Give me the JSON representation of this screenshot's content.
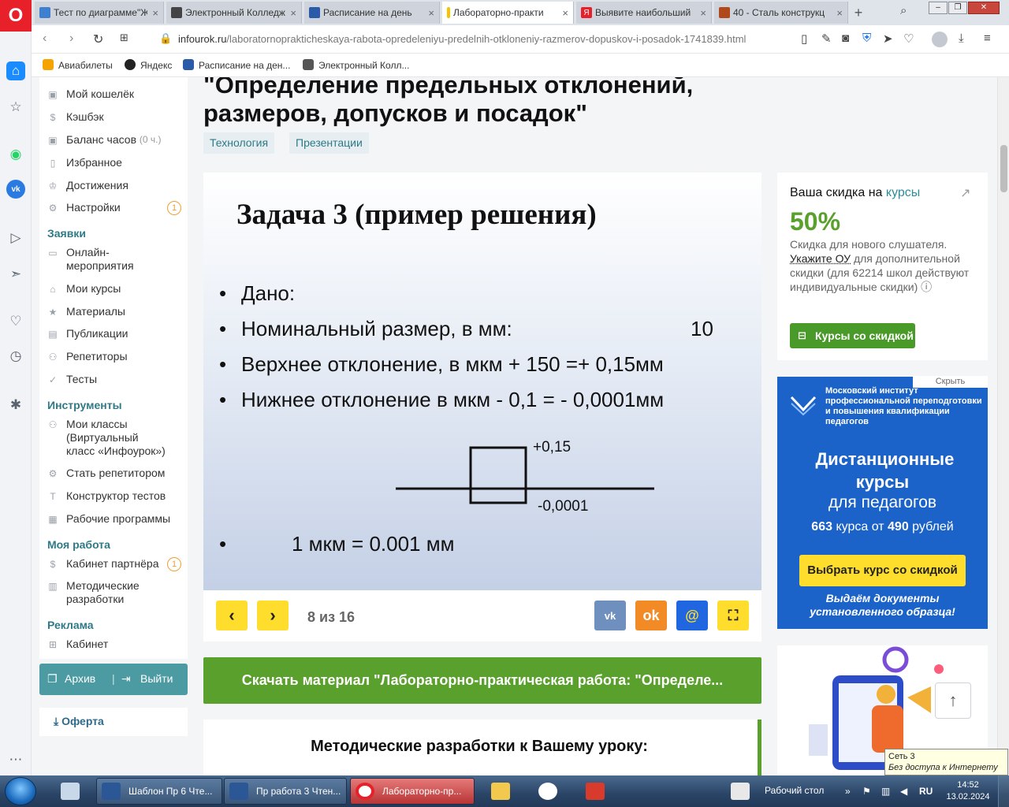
{
  "browser": {
    "tabs": [
      {
        "label": "Тест по диаграмме\"Ж",
        "active": false,
        "color": "#3f7fd0"
      },
      {
        "label": "Электронный Колледж",
        "active": false,
        "color": "#444444"
      },
      {
        "label": "Расписание на день",
        "active": false,
        "color": "#2a5aa8"
      },
      {
        "label": "Лабораторно-практи",
        "active": true,
        "color": "#f5c400"
      },
      {
        "label": "Выявите наибольший",
        "active": false,
        "color": "#e8202a"
      },
      {
        "label": "40 - Сталь конструкц",
        "active": false,
        "color": "#b0481c"
      }
    ],
    "url_host": "infourok.ru",
    "url_path": "/laboratornoprakticheskaya-rabota-opredeleniyu-predelnih-otkloneniy-razmerov-dopuskov-i-posadok-1741839.html",
    "bookmarks": [
      {
        "label": "Авиабилеты",
        "color": "#f5a300"
      },
      {
        "label": "Яндекс",
        "color": "#222222"
      },
      {
        "label": "Расписание на ден...",
        "color": "#2a5aa8"
      },
      {
        "label": "Электронный Колл...",
        "color": "#555555"
      }
    ]
  },
  "sidebar": {
    "items": [
      {
        "label": "Мой кошелёк",
        "icon": "wallet-icon"
      },
      {
        "label": "Кэшбэк",
        "icon": "cashback-icon"
      },
      {
        "label": "Баланс часов",
        "suffix": "(0 ч.)",
        "icon": "hours-icon"
      },
      {
        "label": "Избранное",
        "icon": "bookmark-icon"
      },
      {
        "label": "Достижения",
        "icon": "trophy-icon"
      },
      {
        "label": "Настройки",
        "icon": "gear-icon",
        "badge": "1"
      }
    ],
    "sections": [
      {
        "title": "Заявки",
        "items": [
          "Онлайн-мероприятия",
          "Мои курсы",
          "Материалы",
          "Публикации",
          "Репетиторы",
          "Тесты"
        ]
      },
      {
        "title": "Инструменты",
        "items": [
          "Мои классы (Виртуальный класс «Инфоурок»)",
          "Стать репетитором",
          "Конструктор тестов",
          "Рабочие программы"
        ]
      },
      {
        "title": "Моя работа",
        "items": [
          "Кабинет партнёра",
          "Методические разработки"
        ],
        "badge": "1"
      },
      {
        "title": "Реклама",
        "items": [
          "Кабинет"
        ]
      }
    ],
    "archive_label": "Архив",
    "logout_label": "Выйти",
    "oferta_label": "Оферта"
  },
  "main": {
    "title_line1": "\"Определение предельных отклонений,",
    "title_line2": "размеров, допусков и посадок\"",
    "tags": [
      "Технология",
      "Презентации"
    ],
    "slide": {
      "title": "Задача 3 (пример решения)",
      "given": "Дано:",
      "nominal_label": "Номинальный размер, в мм:",
      "nominal_value": "10",
      "upper": "Верхнее отклонение, в мкм  + 150 =+ 0,15мм",
      "lower": "Нижнее отклонение в мкм  - 0,1 = - 0,0001мм",
      "label_upper": "+0,15",
      "label_lower": "-0,0001",
      "conversion": "1 мкм = 0.001  мм"
    },
    "counter": "8 из 16",
    "share": [
      "vk-icon",
      "ok-icon",
      "mail-icon",
      "fullscreen-icon"
    ],
    "download_label": "Скачать материал \"Лабораторно-практическая работа: \"Определе...",
    "methods_title": "Методические разработки к Вашему уроку:"
  },
  "promo": {
    "head": "Ваша скидка на ",
    "head_link": "курсы",
    "percent": "50%",
    "desc_1": "Скидка для нового слушателя.",
    "desc_link": "Укажите ОУ",
    "desc_2": " для дополнительной скидки (для 62214 школ действуют индивидуальные скидки)",
    "button": "Курсы со скидкой"
  },
  "ad": {
    "hide": "Скрыть",
    "org": "Московский институт профессиональной переподготовки и повышения квалификации педагогов",
    "big1": "Дистанционные курсы",
    "big2": "для педагогов",
    "price_count": "663",
    "price_mid": " курса от ",
    "price_value": "490",
    "price_unit": " рублей",
    "button": "Выбрать курс со скидкой",
    "foot": "Выдаём документы установленного образца!"
  },
  "tooltip": {
    "line1": "Сеть  3",
    "line2": "Без доступа к Интернету"
  },
  "taskbar": {
    "items": [
      {
        "label": "Шаблон Пр 6 Чте...",
        "color": "#2b5797"
      },
      {
        "label": "Пр работа 3 Чтен...",
        "color": "#2b5797"
      },
      {
        "label": "Лабораторно-пр...",
        "color": "#e8202a",
        "active": true
      }
    ],
    "desktop_label": "Рабочий стол",
    "lang": "RU",
    "time": "14:52",
    "date": "13.02.2024"
  },
  "colors": {
    "accent": "#2f7a86",
    "green": "#5aa02c",
    "yellow": "#ffdd2d",
    "ad_blue": "#1b63c8"
  }
}
